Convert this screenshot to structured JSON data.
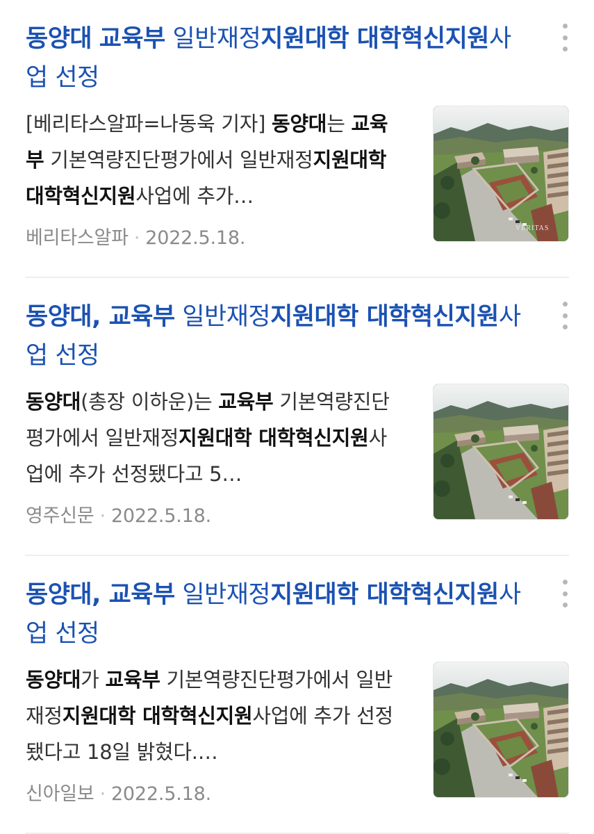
{
  "articles": [
    {
      "title_segments": [
        {
          "text": "동양대",
          "bold": true
        },
        {
          "text": " ",
          "bold": false
        },
        {
          "text": "교육부",
          "bold": true
        },
        {
          "text": " 일반재정",
          "bold": false
        },
        {
          "text": "지원대학 대학혁신지원",
          "bold": true
        },
        {
          "text": "사업 선정",
          "bold": false
        }
      ],
      "summary_segments": [
        {
          "text": "[베리타스알파=나동욱 기자] ",
          "bold": false
        },
        {
          "text": "동양대",
          "bold": true
        },
        {
          "text": "는 ",
          "bold": false
        },
        {
          "text": "교육부",
          "bold": true
        },
        {
          "text": " 기본역량진단평가에서 일반재정",
          "bold": false
        },
        {
          "text": "지원대학 대학혁신지원",
          "bold": true
        },
        {
          "text": "사업에 추가…",
          "bold": false
        }
      ],
      "source": "베리타스알파",
      "date": "2022.5.18.",
      "thumbnail_watermark": "VERITAS"
    },
    {
      "title_segments": [
        {
          "text": "동양대, 교육부",
          "bold": true
        },
        {
          "text": " 일반재정",
          "bold": false
        },
        {
          "text": "지원대학 대학혁신지원",
          "bold": true
        },
        {
          "text": "사업 선정",
          "bold": false
        }
      ],
      "summary_segments": [
        {
          "text": "동양대",
          "bold": true
        },
        {
          "text": "(총장 이하운)는 ",
          "bold": false
        },
        {
          "text": "교육부",
          "bold": true
        },
        {
          "text": " 기본역량진단평가에서 일반재정",
          "bold": false
        },
        {
          "text": "지원대학 대학혁신지원",
          "bold": true
        },
        {
          "text": "사업에 추가 선정됐다고 5…",
          "bold": false
        }
      ],
      "source": "영주신문",
      "date": "2022.5.18.",
      "thumbnail_watermark": ""
    },
    {
      "title_segments": [
        {
          "text": "동양대, 교육부",
          "bold": true
        },
        {
          "text": " 일반재정",
          "bold": false
        },
        {
          "text": "지원대학 대학혁신지원",
          "bold": true
        },
        {
          "text": "사업 선정",
          "bold": false
        }
      ],
      "summary_segments": [
        {
          "text": "동양대",
          "bold": true
        },
        {
          "text": "가 ",
          "bold": false
        },
        {
          "text": "교육부",
          "bold": true
        },
        {
          "text": " 기본역량진단평가에서 일반재정",
          "bold": false
        },
        {
          "text": "지원대학 대학혁신지원",
          "bold": true
        },
        {
          "text": "사업에 추가 선정됐다고 18일 밝혔다.…",
          "bold": false
        }
      ],
      "source": "신아일보",
      "date": "2022.5.18.",
      "thumbnail_watermark": ""
    }
  ],
  "meta_separator": "·",
  "icons": {
    "more": "more-vertical-icon"
  },
  "colors": {
    "title": "#1b52b2",
    "summary": "#333333",
    "meta": "#8a8a8a",
    "divider": "#eeeeee"
  }
}
